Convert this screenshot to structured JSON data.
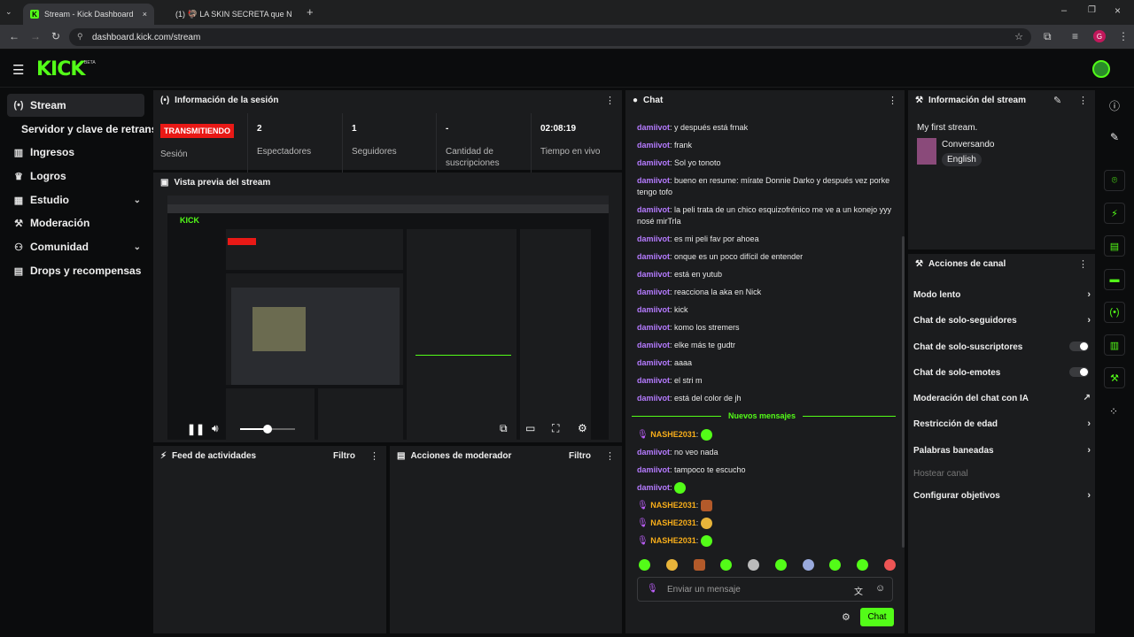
{
  "browser": {
    "tabs": [
      {
        "label": "Stream - Kick Dashboard"
      },
      {
        "label": "(1) 🦃 LA SKIN SECRETA que N"
      }
    ],
    "url": "dashboard.kick.com/stream"
  },
  "app": {
    "logo": "KICK",
    "logo_badge": "BETA"
  },
  "sidebar": {
    "items": [
      {
        "label": "Stream",
        "icon": "broadcast-icon"
      },
      {
        "label": "Servidor y clave de retransm"
      },
      {
        "label": "Ingresos",
        "icon": "chart-icon"
      },
      {
        "label": "Logros",
        "icon": "trophy-icon"
      },
      {
        "label": "Estudio",
        "icon": "grid-icon"
      },
      {
        "label": "Moderación",
        "icon": "wrench-icon"
      },
      {
        "label": "Comunidad",
        "icon": "people-icon"
      },
      {
        "label": "Drops y recompensas",
        "icon": "gift-icon"
      }
    ]
  },
  "session": {
    "title": "Información de la sesión",
    "status_badge": "TRANSMITIENDO",
    "session_label": "Sesión",
    "stats": [
      {
        "value": "2",
        "label": "Espectadores"
      },
      {
        "value": "1",
        "label": "Seguidores"
      },
      {
        "value": "-",
        "label": "Cantidad de suscripciones"
      },
      {
        "value": "02:08:19",
        "label": "Tiempo en vivo"
      }
    ]
  },
  "preview": {
    "title": "Vista previa del stream",
    "volume_level": 0.5
  },
  "activity": {
    "title": "Feed de actividades",
    "filter": "Filtro"
  },
  "modactions": {
    "title": "Acciones de moderador",
    "filter": "Filtro"
  },
  "chat": {
    "title": "Chat",
    "messages": [
      {
        "user": "damiivot",
        "text": ": y después está frnak"
      },
      {
        "user": "damiivot",
        "text": ": frank"
      },
      {
        "user": "damiivot",
        "text": ": Sol yo tonoto"
      },
      {
        "user": "damiivot",
        "text": ": bueno en resume: mírate Donnie Darko y después vez porke tengo tofo"
      },
      {
        "user": "damiivot",
        "text": ": la peli trata de un chico esquizofrénico me ve a un konejo yyy nosé mirTrla"
      },
      {
        "user": "damiivot",
        "text": ": es mi peli fav por ahoea"
      },
      {
        "user": "damiivot",
        "text": ": onque es un poco difícil de entender"
      },
      {
        "user": "damiivot",
        "text": ": está en yutub"
      },
      {
        "user": "damiivot",
        "text": ": reacciona la aka en Nick"
      },
      {
        "user": "damiivot",
        "text": ": kick"
      },
      {
        "user": "damiivot",
        "text": ": komo los stremers"
      },
      {
        "user": "damiivot",
        "text": ": elke más te gudtr"
      },
      {
        "user": "damiivot",
        "text": ": aaaa"
      },
      {
        "user": "damiivot",
        "text": ": el stri m"
      },
      {
        "user": "damiivot",
        "text": ": está del color de jh"
      }
    ],
    "new_messages": "Nuevos mensajes",
    "new": [
      {
        "user": "NASHE2031",
        "text": ":"
      },
      {
        "user": "damiivot",
        "text": ": no veo nada"
      },
      {
        "user": "damiivot",
        "text": ": tampoco te escucho"
      },
      {
        "user": "damiivot",
        "text": ":"
      },
      {
        "user": "NASHE2031",
        "text": ":"
      },
      {
        "user": "NASHE2031",
        "text": ":"
      },
      {
        "user": "NASHE2031",
        "text": ":"
      }
    ],
    "input_placeholder": "Enviar un mensaje",
    "send_label": "Chat"
  },
  "stream_info": {
    "title": "Información del stream",
    "stream_title": "My first stream.",
    "category": "Conversando",
    "language": "English"
  },
  "channel_actions": {
    "title": "Acciones de canal",
    "items": [
      {
        "label": "Modo lento"
      },
      {
        "label": "Chat de solo-seguidores"
      },
      {
        "label": "Chat de solo-suscriptores"
      },
      {
        "label": "Chat de solo-emotes"
      },
      {
        "label": "Moderación del chat con IA"
      },
      {
        "label": "Restricción de edad"
      },
      {
        "label": "Palabras baneadas"
      },
      {
        "label": "Hostear canal"
      },
      {
        "label": "Configurar objetivos"
      }
    ]
  },
  "colors": {
    "brand": "#53fc18",
    "live": "#e91916",
    "username": "#b57bff"
  }
}
